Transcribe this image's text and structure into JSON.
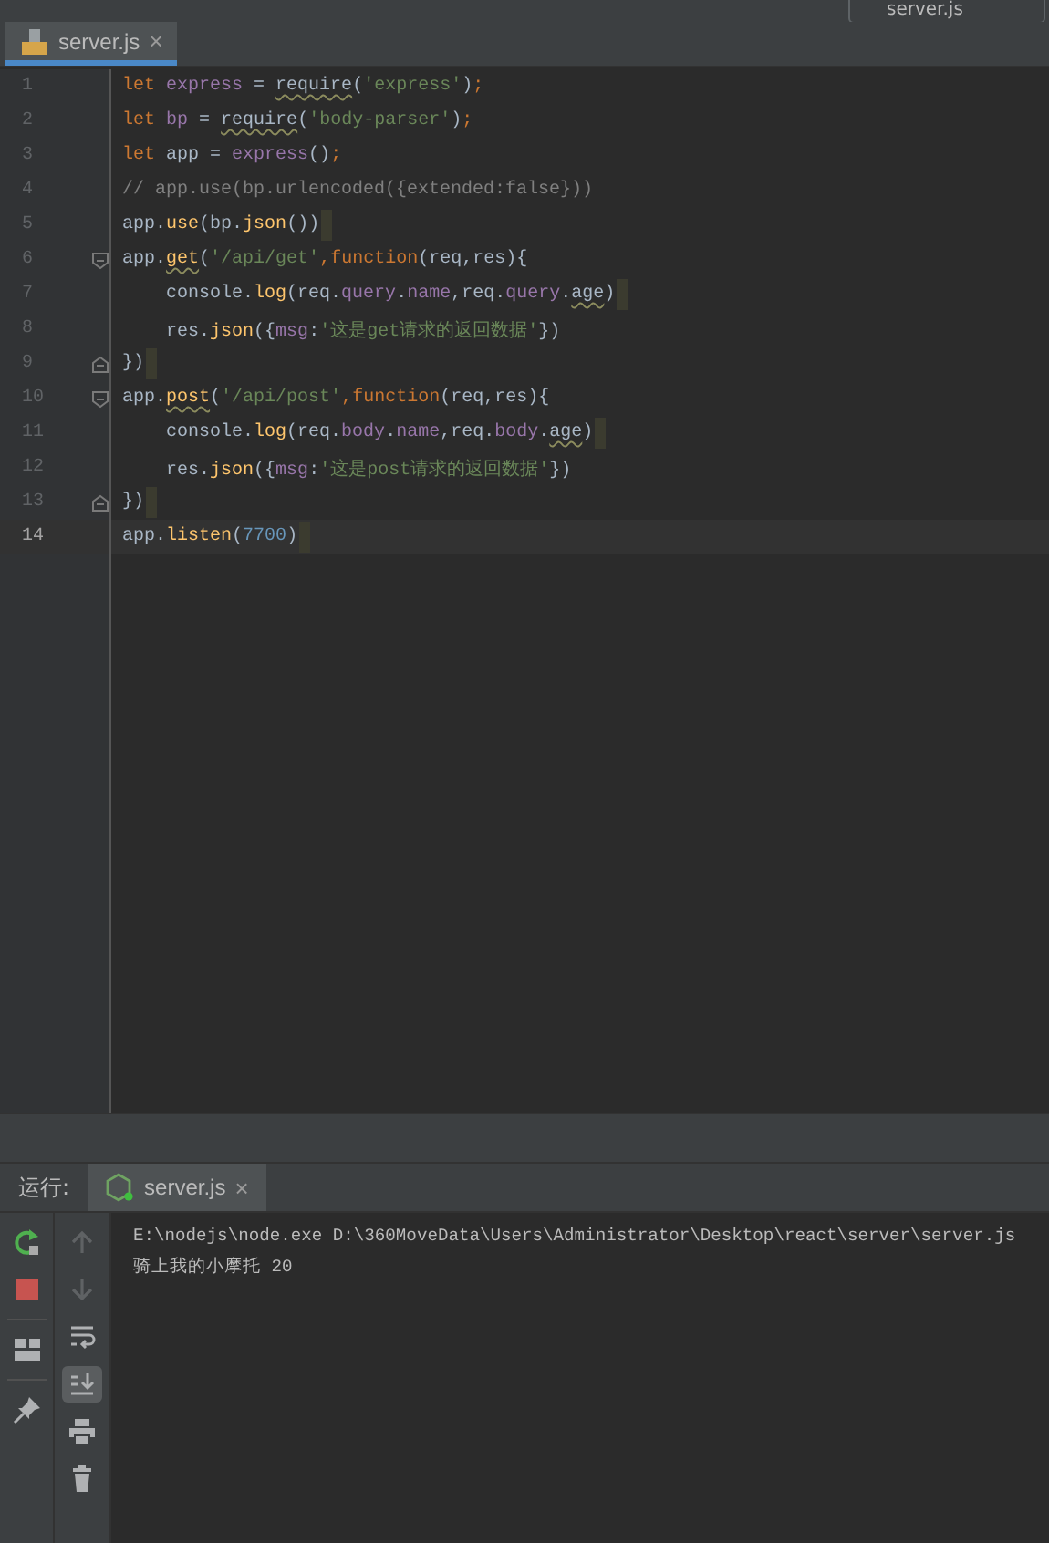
{
  "run_config": {
    "label": "server.js"
  },
  "editor_tabs": [
    {
      "label": "server.js",
      "close": "×",
      "selected": true
    }
  ],
  "code_lines": [
    {
      "number": "1",
      "current": false,
      "end_mark": false,
      "fold_start": false,
      "fold_end": false,
      "tokens": [
        {
          "kind": "kw",
          "text": "let "
        },
        {
          "kind": "var",
          "text": "express"
        },
        {
          "kind": "plain",
          "text": " = "
        },
        {
          "kind": "warn",
          "text": "require"
        },
        {
          "kind": "plain",
          "text": "("
        },
        {
          "kind": "str",
          "text": "'express'"
        },
        {
          "kind": "plain",
          "text": ")"
        },
        {
          "kind": "punct",
          "text": ";"
        }
      ]
    },
    {
      "number": "2",
      "current": false,
      "end_mark": false,
      "fold_start": false,
      "fold_end": false,
      "tokens": [
        {
          "kind": "kw",
          "text": "let "
        },
        {
          "kind": "var",
          "text": "bp"
        },
        {
          "kind": "plain",
          "text": " = "
        },
        {
          "kind": "warn",
          "text": "require"
        },
        {
          "kind": "plain",
          "text": "("
        },
        {
          "kind": "str",
          "text": "'body-parser'"
        },
        {
          "kind": "plain",
          "text": ")"
        },
        {
          "kind": "punct",
          "text": ";"
        }
      ]
    },
    {
      "number": "3",
      "current": false,
      "end_mark": false,
      "fold_start": false,
      "fold_end": false,
      "tokens": [
        {
          "kind": "kw",
          "text": "let "
        },
        {
          "kind": "plain",
          "text": "app = "
        },
        {
          "kind": "var",
          "text": "express"
        },
        {
          "kind": "plain",
          "text": "()"
        },
        {
          "kind": "punct",
          "text": ";"
        }
      ]
    },
    {
      "number": "4",
      "current": false,
      "end_mark": false,
      "fold_start": false,
      "fold_end": false,
      "tokens": [
        {
          "kind": "cmt",
          "text": "// app.use(bp.urlencoded({extended:false}))"
        }
      ]
    },
    {
      "number": "5",
      "current": false,
      "end_mark": true,
      "fold_start": false,
      "fold_end": false,
      "tokens": [
        {
          "kind": "plain",
          "text": "app."
        },
        {
          "kind": "fn",
          "text": "use"
        },
        {
          "kind": "plain",
          "text": "(bp."
        },
        {
          "kind": "fn",
          "text": "json"
        },
        {
          "kind": "plain",
          "text": "())"
        }
      ]
    },
    {
      "number": "6",
      "current": false,
      "end_mark": false,
      "fold_start": true,
      "fold_end": false,
      "tokens": [
        {
          "kind": "plain",
          "text": "app."
        },
        {
          "kind": "fn_warn",
          "text": "get"
        },
        {
          "kind": "plain",
          "text": "("
        },
        {
          "kind": "str",
          "text": "'/api/get'"
        },
        {
          "kind": "punct",
          "text": ","
        },
        {
          "kind": "kw",
          "text": "function"
        },
        {
          "kind": "plain",
          "text": "(req,res){"
        }
      ]
    },
    {
      "number": "7",
      "current": false,
      "end_mark": true,
      "fold_start": false,
      "fold_end": false,
      "tokens": [
        {
          "kind": "plain",
          "text": "    console."
        },
        {
          "kind": "fn",
          "text": "log"
        },
        {
          "kind": "plain",
          "text": "(req."
        },
        {
          "kind": "var",
          "text": "query"
        },
        {
          "kind": "plain",
          "text": "."
        },
        {
          "kind": "var",
          "text": "name"
        },
        {
          "kind": "plain",
          "text": ",req."
        },
        {
          "kind": "var",
          "text": "query"
        },
        {
          "kind": "plain",
          "text": "."
        },
        {
          "kind": "warn",
          "text": "age"
        },
        {
          "kind": "plain",
          "text": ")"
        }
      ]
    },
    {
      "number": "8",
      "current": false,
      "end_mark": false,
      "fold_start": false,
      "fold_end": false,
      "tokens": [
        {
          "kind": "plain",
          "text": "    res."
        },
        {
          "kind": "fn",
          "text": "json"
        },
        {
          "kind": "plain",
          "text": "({"
        },
        {
          "kind": "var",
          "text": "msg"
        },
        {
          "kind": "plain",
          "text": ":"
        },
        {
          "kind": "str",
          "text": "'这是get请求的返回数据'"
        },
        {
          "kind": "plain",
          "text": "})"
        }
      ]
    },
    {
      "number": "9",
      "current": false,
      "end_mark": true,
      "fold_start": false,
      "fold_end": true,
      "tokens": [
        {
          "kind": "plain",
          "text": "})"
        }
      ]
    },
    {
      "number": "10",
      "current": false,
      "end_mark": false,
      "fold_start": true,
      "fold_end": false,
      "tokens": [
        {
          "kind": "plain",
          "text": "app."
        },
        {
          "kind": "fn_warn",
          "text": "post"
        },
        {
          "kind": "plain",
          "text": "("
        },
        {
          "kind": "str",
          "text": "'/api/post'"
        },
        {
          "kind": "punct",
          "text": ","
        },
        {
          "kind": "kw",
          "text": "function"
        },
        {
          "kind": "plain",
          "text": "(req,res){"
        }
      ]
    },
    {
      "number": "11",
      "current": false,
      "end_mark": true,
      "fold_start": false,
      "fold_end": false,
      "tokens": [
        {
          "kind": "plain",
          "text": "    console."
        },
        {
          "kind": "fn",
          "text": "log"
        },
        {
          "kind": "plain",
          "text": "(req."
        },
        {
          "kind": "var",
          "text": "body"
        },
        {
          "kind": "plain",
          "text": "."
        },
        {
          "kind": "var",
          "text": "name"
        },
        {
          "kind": "plain",
          "text": ",req."
        },
        {
          "kind": "var",
          "text": "body"
        },
        {
          "kind": "plain",
          "text": "."
        },
        {
          "kind": "warn",
          "text": "age"
        },
        {
          "kind": "plain",
          "text": ")"
        }
      ]
    },
    {
      "number": "12",
      "current": false,
      "end_mark": false,
      "fold_start": false,
      "fold_end": false,
      "tokens": [
        {
          "kind": "plain",
          "text": "    res."
        },
        {
          "kind": "fn",
          "text": "json"
        },
        {
          "kind": "plain",
          "text": "({"
        },
        {
          "kind": "var",
          "text": "msg"
        },
        {
          "kind": "plain",
          "text": ":"
        },
        {
          "kind": "str",
          "text": "'这是post请求的返回数据'"
        },
        {
          "kind": "plain",
          "text": "})"
        }
      ]
    },
    {
      "number": "13",
      "current": false,
      "end_mark": true,
      "fold_start": false,
      "fold_end": true,
      "tokens": [
        {
          "kind": "plain",
          "text": "})"
        }
      ]
    },
    {
      "number": "14",
      "current": true,
      "end_mark": true,
      "fold_start": false,
      "fold_end": false,
      "tokens": [
        {
          "kind": "plain",
          "text": "app."
        },
        {
          "kind": "fn",
          "text": "listen"
        },
        {
          "kind": "plain",
          "text": "("
        },
        {
          "kind": "num",
          "text": "7700"
        },
        {
          "kind": "plain",
          "text": ")"
        }
      ]
    }
  ],
  "run_panel": {
    "label": "运行:",
    "tabs": [
      {
        "label": "server.js",
        "close": "×",
        "selected": true
      }
    ],
    "tools": [
      {
        "kind": "up",
        "disabled": true
      },
      {
        "kind": "down",
        "disabled": true
      },
      {
        "kind": "wrap",
        "on": false
      },
      {
        "kind": "scroll_end",
        "on": true
      },
      {
        "kind": "print"
      },
      {
        "kind": "trash"
      }
    ],
    "output": [
      "E:\\nodejs\\node.exe D:\\360MoveData\\Users\\Administrator\\Desktop\\react\\server\\server.js",
      "骑上我的小摩托 20"
    ]
  }
}
